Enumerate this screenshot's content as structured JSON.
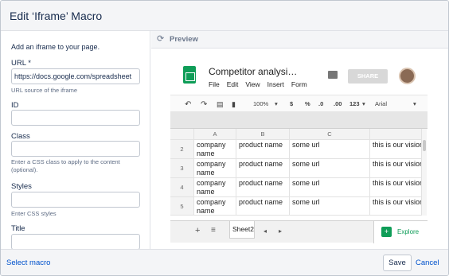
{
  "dialog": {
    "title": "Edit ‘Iframe’ Macro"
  },
  "form": {
    "intro": "Add an iframe to your page.",
    "url": {
      "label": "URL *",
      "value": "https://docs.google.com/spreadsheet",
      "hint": "URL source of the iframe"
    },
    "id": {
      "label": "ID",
      "value": ""
    },
    "class": {
      "label": "Class",
      "value": "",
      "hint": "Enter a CSS class to apply to the content (optional)."
    },
    "styles": {
      "label": "Styles",
      "value": "",
      "hint": "Enter CSS styles"
    },
    "title": {
      "label": "Title",
      "value": ""
    }
  },
  "preview": {
    "label": "Preview"
  },
  "sheet": {
    "doc_title": "Competitor analysi…",
    "menu": [
      "File",
      "Edit",
      "View",
      "Insert",
      "Form"
    ],
    "share_label": "SHARE",
    "toolbar": {
      "zoom": "100%",
      "currency": "$",
      "percent": "%",
      "dec_less": ".0",
      "dec_more": ".00",
      "number_format": "123",
      "font": "Arial"
    },
    "columns": [
      "A",
      "B",
      "C"
    ],
    "rows": [
      {
        "num": "2",
        "a": "company name",
        "b": "product name",
        "c": "some url",
        "d": "this is our vision"
      },
      {
        "num": "3",
        "a": "company name",
        "b": "product name",
        "c": "some url",
        "d": "this is our vision"
      },
      {
        "num": "4",
        "a": "company name",
        "b": "product name",
        "c": "some url",
        "d": "this is our vision"
      },
      {
        "num": "5",
        "a": "company name",
        "b": "product name",
        "c": "some url",
        "d": "this is our vision"
      }
    ],
    "tab_name": "Sheet2",
    "explore_label": "Explore"
  },
  "footer": {
    "select_macro": "Select macro",
    "save": "Save",
    "cancel": "Cancel"
  },
  "colors": {
    "link": "#0052cc",
    "sheets_green": "#0f9d58"
  }
}
